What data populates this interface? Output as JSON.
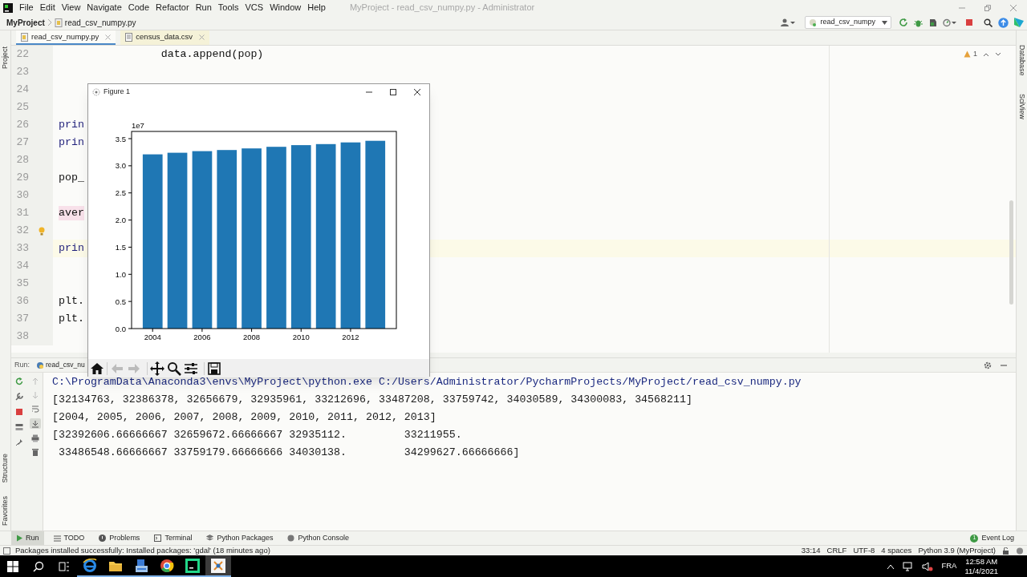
{
  "window": {
    "title": "MyProject - read_csv_numpy.py - Administrator",
    "menu": [
      "File",
      "Edit",
      "View",
      "Navigate",
      "Code",
      "Refactor",
      "Run",
      "Tools",
      "VCS",
      "Window",
      "Help"
    ]
  },
  "navigation_bar": {
    "project": "MyProject",
    "file": "read_csv_numpy.py",
    "run_configuration": "read_csv_numpy"
  },
  "editor_tabs": [
    {
      "label": "read_csv_numpy.py",
      "selected": true,
      "kind": "python"
    },
    {
      "label": "census_data.csv",
      "selected": false,
      "kind": "csv"
    }
  ],
  "side_panels": {
    "left_top": [
      "Project"
    ],
    "left_bottom": [
      "Structure",
      "Favorites"
    ],
    "right": [
      "Database",
      "SciView"
    ]
  },
  "editor": {
    "warning_count": "1",
    "lines": [
      {
        "number": "22",
        "code": "                data.append(pop)",
        "kind": "plain",
        "error": false,
        "current": false,
        "bulb": false
      },
      {
        "number": "23",
        "error": false,
        "current": false,
        "bulb": false
      },
      {
        "number": "24",
        "error": false,
        "current": false,
        "bulb": false
      },
      {
        "number": "25",
        "error": false,
        "current": false,
        "bulb": false
      },
      {
        "number": "26",
        "code": "prin",
        "kind": "builtin",
        "error": false,
        "current": false,
        "bulb": false
      },
      {
        "number": "27",
        "code": "prin",
        "kind": "builtin",
        "error": false,
        "current": false,
        "bulb": false
      },
      {
        "number": "28",
        "error": false,
        "current": false,
        "bulb": false
      },
      {
        "number": "29",
        "code": "pop_",
        "kind": "plain",
        "error": false,
        "current": false,
        "bulb": false
      },
      {
        "number": "30",
        "error": false,
        "current": false,
        "bulb": false
      },
      {
        "number": "31",
        "code": "aver",
        "kind": "plain",
        "error": true,
        "current": false,
        "bulb": false
      },
      {
        "number": "32",
        "error": false,
        "current": false,
        "bulb": true
      },
      {
        "number": "33",
        "code": "prin",
        "kind": "builtin",
        "error": false,
        "current": true,
        "bulb": false
      },
      {
        "number": "34",
        "error": false,
        "current": false,
        "bulb": false
      },
      {
        "number": "35",
        "error": false,
        "current": false,
        "bulb": false
      },
      {
        "number": "36",
        "code": "plt.",
        "kind": "plain",
        "error": false,
        "current": false,
        "bulb": false
      },
      {
        "number": "37",
        "code": "plt.",
        "kind": "plain",
        "error": false,
        "current": false,
        "bulb": false
      },
      {
        "number": "38",
        "error": false,
        "current": false,
        "bulb": false
      }
    ]
  },
  "figure_window": {
    "title": "Figure 1",
    "chart_data": {
      "type": "bar",
      "categories": [
        "2004",
        null,
        "2006",
        null,
        "2008",
        null,
        "2010",
        null,
        "2012",
        null
      ],
      "series": [
        {
          "color": "#1f77b4",
          "values": [
            3.21,
            3.24,
            3.27,
            3.29,
            3.32,
            3.35,
            3.38,
            3.4,
            3.43,
            3.46
          ]
        }
      ],
      "ylim": [
        0,
        3.633
      ],
      "yticks": [
        {
          "value": 0,
          "label": "0.0"
        },
        {
          "value": 0.5,
          "label": "0.5"
        },
        {
          "value": 1,
          "label": "1.0"
        },
        {
          "value": 1.5,
          "label": "1.5"
        },
        {
          "value": 2,
          "label": "2.0"
        },
        {
          "value": 2.5,
          "label": "2.5"
        },
        {
          "value": 3,
          "label": "3.0"
        },
        {
          "value": 3.5,
          "label": "3.5"
        }
      ],
      "annotations": [
        {
          "text": "1e7"
        }
      ]
    }
  },
  "run_panel": {
    "label": "Run:",
    "tab": "read_csv_nu",
    "output": [
      {
        "kind": "command",
        "text": "C:\\ProgramData\\Anaconda3\\envs\\MyProject\\python.exe C:/Users/Administrator/PycharmProjects/MyProject/read_csv_numpy.py"
      },
      {
        "kind": "stdout",
        "text": "[32134763, 32386378, 32656679, 32935961, 33212696, 33487208, 33759742, 34030589, 34300083, 34568211]"
      },
      {
        "kind": "stdout",
        "text": "[2004, 2005, 2006, 2007, 2008, 2009, 2010, 2011, 2012, 2013]"
      },
      {
        "kind": "stdout",
        "text": "[32392606.66666667 32659672.66666667 32935112.         33211955."
      },
      {
        "kind": "stdout",
        "text": " 33486548.66666667 33759179.66666666 34030138.         34299627.66666666]"
      }
    ]
  },
  "tool_tabs": [
    {
      "label": "Run",
      "selected": true,
      "kind": "run"
    },
    {
      "label": "TODO",
      "selected": false,
      "kind": "todo"
    },
    {
      "label": "Problems",
      "selected": false,
      "kind": "problems"
    },
    {
      "label": "Terminal",
      "selected": false,
      "kind": "terminal"
    },
    {
      "label": "Python Packages",
      "selected": false,
      "kind": "packages"
    },
    {
      "label": "Python Console",
      "selected": false,
      "kind": "console"
    }
  ],
  "event_log": {
    "label": "Event Log",
    "count": "1"
  },
  "status_bar": {
    "message": "Packages installed successfully: Installed packages: 'gdal' (18 minutes ago)",
    "items": [
      "33:14",
      "CRLF",
      "UTF-8",
      "4 spaces",
      "Python 3.9 (MyProject)"
    ]
  },
  "taskbar": {
    "apps": [
      {
        "kind": "browser",
        "selected": false
      },
      {
        "kind": "folder",
        "selected": false
      },
      {
        "kind": "server",
        "selected": false
      },
      {
        "kind": "chrome",
        "selected": false
      },
      {
        "kind": "ide",
        "selected": false
      },
      {
        "kind": "figure",
        "selected": true
      }
    ],
    "language": "FRA",
    "time": "12:58 AM",
    "date": "11/4/2021"
  }
}
